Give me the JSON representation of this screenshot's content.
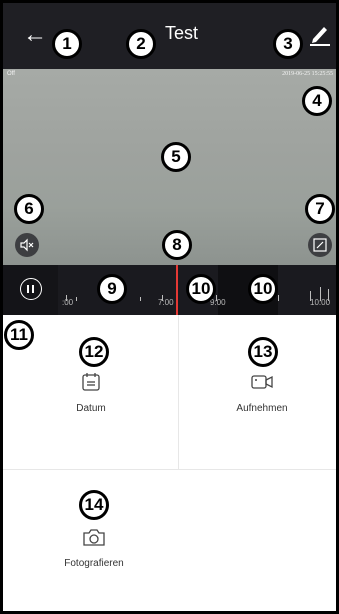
{
  "header": {
    "back_icon": "arrow-left-icon",
    "title": "Test",
    "edit_icon": "pencil-icon"
  },
  "video": {
    "top_left_text": "Off",
    "timestamp": "2019-06-25 15:25:55",
    "mute_icon": "speaker-muted-icon",
    "fullscreen_icon": "fullscreen-icon"
  },
  "timeline": {
    "pause_icon": "pause-icon",
    "labels": [
      ":00",
      "7:00",
      "9:00",
      "10:00"
    ]
  },
  "functions": {
    "date_label": "Datum",
    "record_label": "Aufnehmen",
    "photo_label": "Fotografieren",
    "date_icon": "calendar-icon",
    "record_icon": "video-camera-icon",
    "photo_icon": "camera-icon"
  },
  "markers": [
    "1",
    "2",
    "3",
    "4",
    "5",
    "6",
    "7",
    "8",
    "9",
    "10",
    "10",
    "11",
    "12",
    "13",
    "14"
  ],
  "colors": {
    "header_bg": "#1f1f24",
    "timeline_bg": "#141418",
    "cursor": "#e53935"
  }
}
